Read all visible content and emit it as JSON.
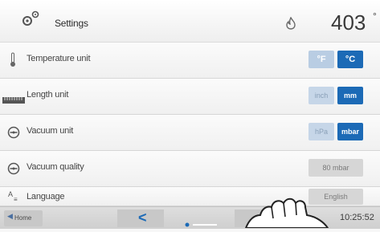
{
  "header": {
    "title": "Settings",
    "temperature": "403",
    "temperature_unit_suffix": "°"
  },
  "rows": [
    {
      "label": "Temperature unit",
      "icon": "thermometer-icon",
      "options": [
        "°F",
        "°C"
      ],
      "selected": "°C"
    },
    {
      "label": "Length unit",
      "icon": "ruler-icon",
      "options": [
        "inch",
        "mm"
      ],
      "selected": "mm"
    },
    {
      "label": "Vacuum unit",
      "icon": "vacuum-gauge-icon",
      "options": [
        "hPa",
        "mbar"
      ],
      "selected": "mbar"
    },
    {
      "label": "Vacuum quality",
      "icon": "vacuum-gauge-icon",
      "value": "80 mbar"
    },
    {
      "label": "Language",
      "icon": "language-icon",
      "value": "English"
    }
  ],
  "footer": {
    "home_label": "Home",
    "back_glyph": "<",
    "time": "10:25:52"
  },
  "colors": {
    "accent": "#1c6ab6",
    "inactive_option": "#c6d6e8"
  }
}
